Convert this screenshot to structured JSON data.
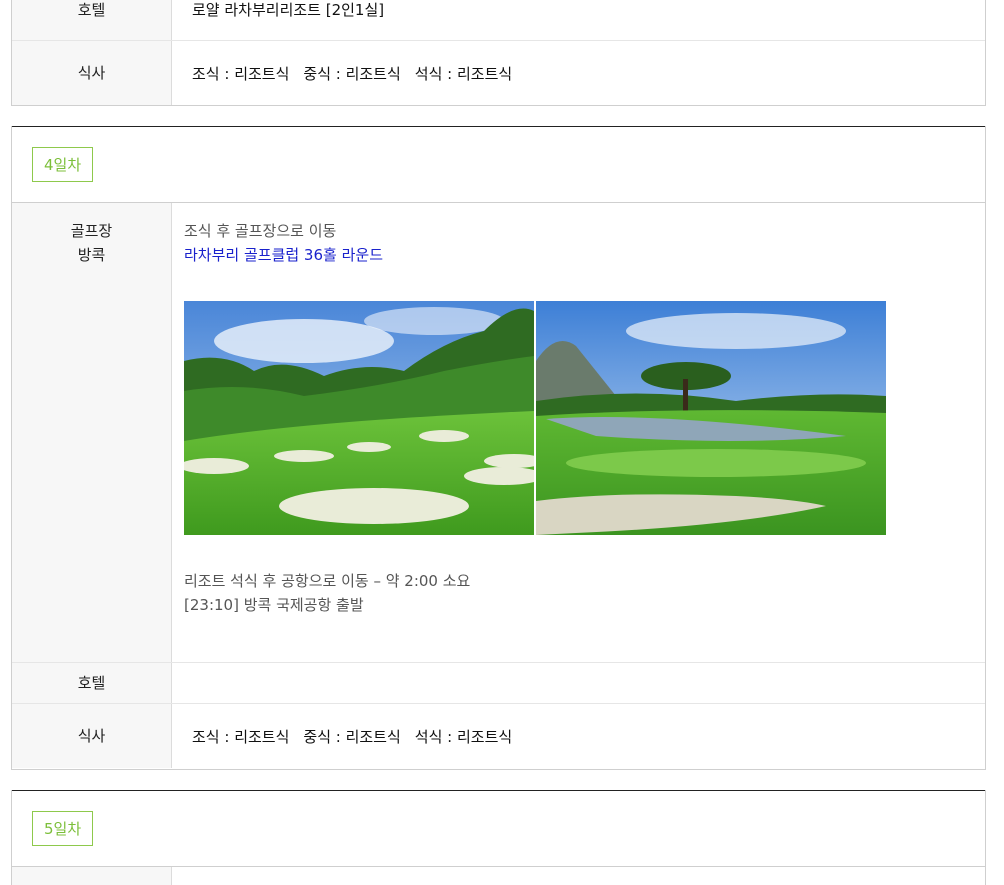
{
  "day3": {
    "hotel_label": "호텔",
    "hotel_value": "로얄 라차부리리조트 [2인1실]",
    "meal_label": "식사",
    "meals": [
      "조식 : 리조트식",
      "중식 : 리조트식",
      "석식 : 리조트식"
    ]
  },
  "day4": {
    "badge": "4일차",
    "place_label_line1": "골프장",
    "place_label_line2": "방콕",
    "schedule_line1": "조식 후 골프장으로 이동",
    "schedule_line2": "라차부리 골프클럽 36홀 라운드",
    "photos": [
      "golf-course-bunkers-photo",
      "golf-course-lake-photo"
    ],
    "schedule_line3": "리조트 석식 후 공항으로 이동 – 약 2:00 소요",
    "schedule_line4": "[23:10] 방콕 국제공항 출발",
    "hotel_label": "호텔",
    "hotel_value": "",
    "meal_label": "식사",
    "meals": [
      "조식 : 리조트식",
      "중식 : 리조트식",
      "석식 : 리조트식"
    ]
  },
  "day5": {
    "badge": "5일차"
  },
  "colors": {
    "badge_green": "#7cbf3a",
    "link_blue": "#1a22cc",
    "label_bg": "#f7f7f7"
  }
}
